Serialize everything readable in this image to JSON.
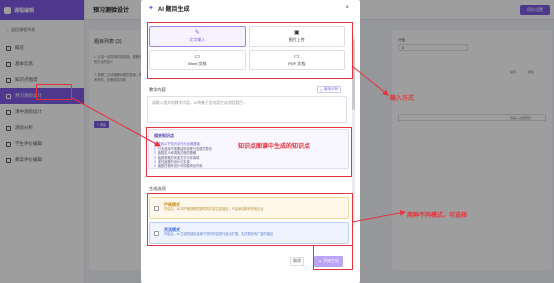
{
  "app": {
    "brand": "课程编辑",
    "back_link": "← 返回课程列表",
    "page_title": "预习测验设计",
    "save_button": "保存设置",
    "sidebar": [
      {
        "label": "概览",
        "icon": "grid-icon",
        "active": false
      },
      {
        "label": "基本信息",
        "icon": "info-icon",
        "active": false
      },
      {
        "label": "知识点图谱",
        "icon": "graph-icon",
        "active": false
      },
      {
        "label": "预习测验设计",
        "icon": "quiz-icon",
        "active": true
      },
      {
        "label": "课中测验设计",
        "icon": "quiz-icon",
        "active": false
      },
      {
        "label": "测验分析",
        "icon": "chart-icon",
        "active": false
      },
      {
        "label": "学生评价编辑",
        "icon": "edit-icon",
        "active": false
      },
      {
        "label": "教案评价编辑",
        "icon": "edit-icon",
        "active": false
      }
    ],
    "left_panel": {
      "heading": "题目列表 (3)",
      "text_1": "1. 已选一道简单的选择题，理解全局知识点的含义",
      "text_2": "2. 按照二分法理解问题的答案，再参考资料，正确回答问题",
      "chip": "+ 添加"
    },
    "right_panel": {
      "label_a": "分值",
      "value_a": "5",
      "label_b": "编辑",
      "label_c": "删除",
      "hint": "请输入试题题目"
    }
  },
  "modal": {
    "title": "AI 题目生成",
    "close": "×",
    "input_types": [
      {
        "label": "文字输入",
        "glyph": "✎",
        "icon": "text-input-icon",
        "selected": true
      },
      {
        "label": "图片上传",
        "glyph": "▣",
        "icon": "image-upload-icon",
        "selected": false
      },
      {
        "label": "Word 文档",
        "glyph": "▭",
        "icon": "word-doc-icon",
        "selected": false
      },
      {
        "label": "PDF 文档",
        "glyph": "▭",
        "icon": "pdf-doc-icon",
        "selected": false
      }
    ],
    "content_label": "教学内容",
    "sample_button": "使用示例",
    "textarea_placeholder": "请输入相关的教学内容，AI将基于此内容生成测验题目...",
    "knowledge": {
      "title": "相关知识点",
      "intro": "AI检测以下知识点作为出题基础：",
      "items": [
        {
          "num": "1",
          "text": "分支选择不需要结构化等分支模式算法"
        },
        {
          "num": "2",
          "text": "函数定义和调用过程的理解"
        },
        {
          "num": "3",
          "text": "函数参数的传递方式与作用域"
        },
        {
          "num": "4",
          "text": "递归函数的设计与实现"
        },
        {
          "num": "5",
          "text": "函数在程序设计中的模块化作用"
        }
      ]
    },
    "mode_label": "生成选项",
    "modes": [
      {
        "name": "严格模式",
        "desc": "开启后，AI 将严格按照您提供的内容生成题目，不会添加额外的知识点"
      },
      {
        "name": "灵活模式",
        "desc": "开启后，AI 生成的题目会基于您的内容进行适当扩展，生成更具有广度的题目"
      }
    ],
    "cancel_button": "取消",
    "generate_button": "开始生成",
    "generate_glyph": "✦"
  },
  "annotations": {
    "input_methods": "输入方式",
    "knowledge_points": "知识点图谱中生成的知识点",
    "two_modes": "两种不同模式，可选择"
  },
  "colors": {
    "accent": "#7b5ce6",
    "annotation": "#e8323c"
  }
}
